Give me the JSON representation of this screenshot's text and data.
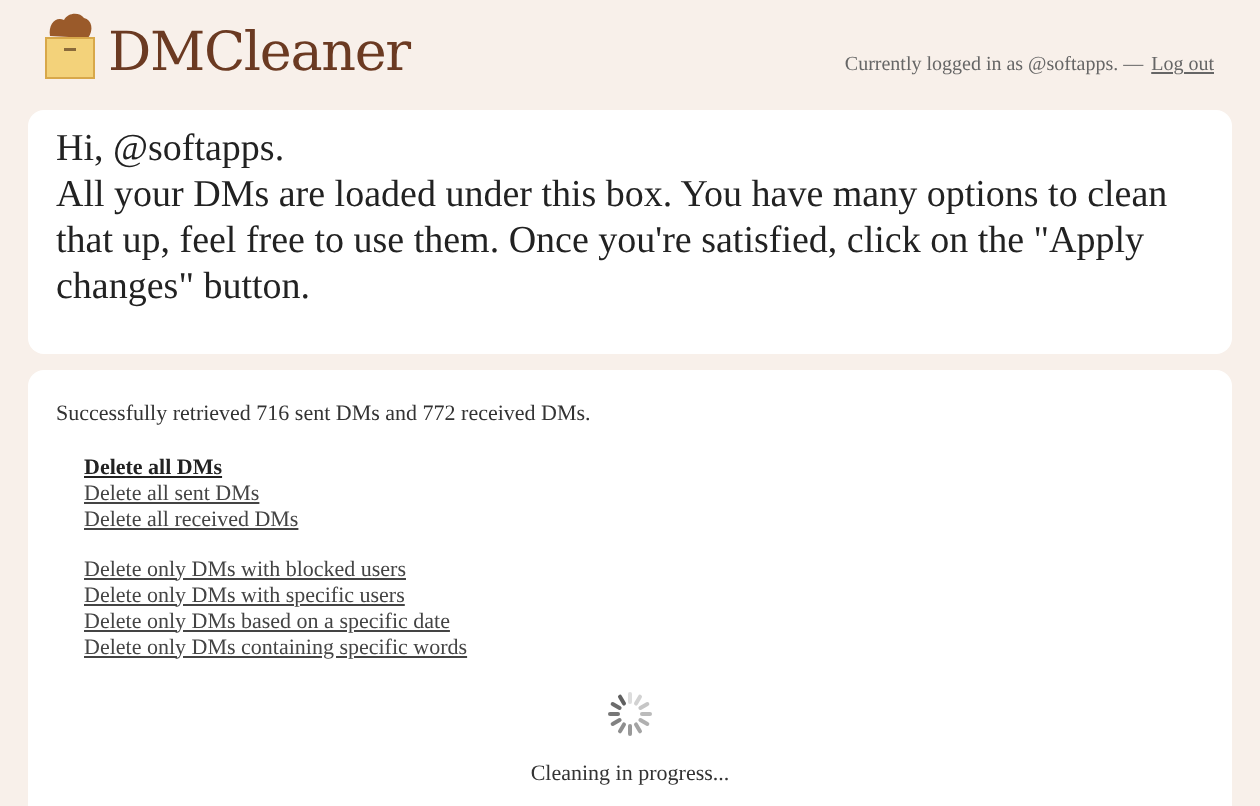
{
  "header": {
    "logo": "DMCleaner",
    "login_text": "Currently logged in as @softapps. —",
    "logout": "Log out"
  },
  "intro": {
    "lines": [
      "Hi, @softapps.",
      "All your DMs are loaded under this box. You have many options to clean that up, feel free to use them. Once you're satisfied, click on the \"Apply changes\" button."
    ]
  },
  "panel": {
    "status": "Successfully retrieved 716 sent DMs and 772 received DMs.",
    "option_groups": [
      [
        {
          "label": "Delete all DMs",
          "selected": true
        },
        {
          "label": "Delete all sent DMs",
          "selected": false
        },
        {
          "label": "Delete all received DMs",
          "selected": false
        }
      ],
      [
        {
          "label": "Delete only DMs with blocked users",
          "selected": false
        },
        {
          "label": "Delete only DMs with specific users",
          "selected": false
        },
        {
          "label": "Delete only DMs based on a specific date",
          "selected": false
        },
        {
          "label": "Delete only DMs containing specific words",
          "selected": false
        }
      ]
    ],
    "progress_text": "Cleaning in progress..."
  }
}
